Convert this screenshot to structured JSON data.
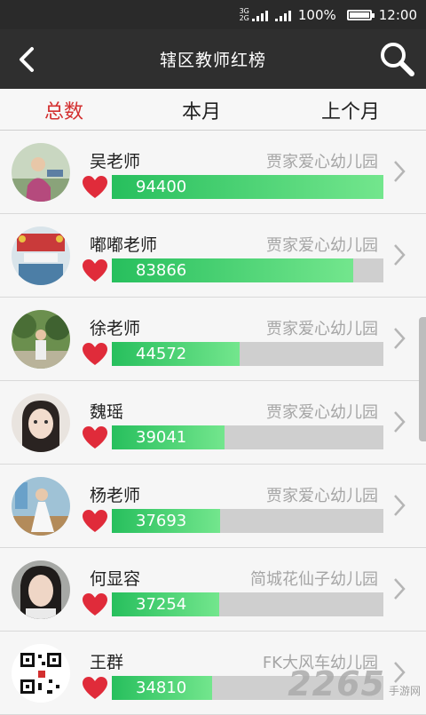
{
  "status": {
    "battery": "100%",
    "time": "12:00",
    "net_top": "3G",
    "net_bottom": "2G"
  },
  "header": {
    "title": "辖区教师红榜"
  },
  "tabs": [
    {
      "label": "总数",
      "active": true
    },
    {
      "label": "本月",
      "active": false
    },
    {
      "label": "上个月",
      "active": false
    }
  ],
  "max_score": 94400,
  "teachers": [
    {
      "name": "吴老师",
      "school": "贾家爱心幼儿园",
      "score": 94400,
      "avatar": "photo-woman-outdoor-icon"
    },
    {
      "name": "嘟嘟老师",
      "school": "贾家爱心幼儿园",
      "score": 83866,
      "avatar": "photo-decorated-room-icon"
    },
    {
      "name": "徐老师",
      "school": "贾家爱心幼儿园",
      "score": 44572,
      "avatar": "photo-person-trees-icon"
    },
    {
      "name": "魏瑶",
      "school": "贾家爱心幼儿园",
      "score": 39041,
      "avatar": "photo-girl-portrait-icon"
    },
    {
      "name": "杨老师",
      "school": "贾家爱心幼儿园",
      "score": 37693,
      "avatar": "photo-woman-white-dress-icon"
    },
    {
      "name": "何显容",
      "school": "简城花仙子幼儿园",
      "score": 37254,
      "avatar": "photo-woman-selfie-icon"
    },
    {
      "name": "王群",
      "school": "FK大风车幼儿园",
      "score": 34810,
      "avatar": "qr-code-icon"
    }
  ],
  "watermark": {
    "number": "2265",
    "site": "手游网"
  },
  "colors": {
    "accent_red": "#d32f2f",
    "bar_green": "#27bf5d",
    "heart": "#e02b3a",
    "header_bg": "#2f2f2f"
  }
}
